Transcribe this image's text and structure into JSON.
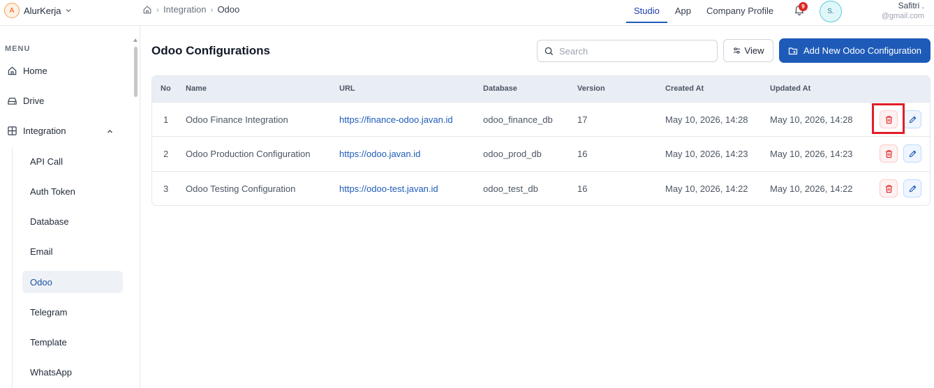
{
  "org": {
    "initial": "A",
    "name": "AlurKerja"
  },
  "breadcrumb": [
    "Integration",
    "Odoo"
  ],
  "topnav": [
    {
      "label": "Studio",
      "active": true
    },
    {
      "label": "App",
      "active": false
    },
    {
      "label": "Company Profile",
      "active": false
    }
  ],
  "notifications": {
    "count": "9"
  },
  "user": {
    "initials": "S.",
    "name": "Safitri .",
    "email": "@gmail.com"
  },
  "sidebar": {
    "menu_label": "MENU",
    "items": [
      {
        "label": "Home",
        "icon": "home-icon"
      },
      {
        "label": "Drive",
        "icon": "drive-icon"
      },
      {
        "label": "Integration",
        "icon": "grid-icon",
        "expanded": true
      }
    ],
    "sub_items": [
      {
        "label": "API Call",
        "active": false
      },
      {
        "label": "Auth Token",
        "active": false
      },
      {
        "label": "Database",
        "active": false
      },
      {
        "label": "Email",
        "active": false
      },
      {
        "label": "Odoo",
        "active": true
      },
      {
        "label": "Telegram",
        "active": false
      },
      {
        "label": "Template",
        "active": false
      },
      {
        "label": "WhatsApp",
        "active": false
      }
    ]
  },
  "main": {
    "title": "Odoo Configurations",
    "search": {
      "placeholder": "Search",
      "value": ""
    },
    "view_label": "View",
    "add_label": "Add New Odoo Configuration"
  },
  "table": {
    "columns": [
      "No",
      "Name",
      "URL",
      "Database",
      "Version",
      "Created At",
      "Updated At"
    ],
    "rows": [
      {
        "no": "1",
        "name": "Odoo Finance Integration",
        "url": "https://finance-odoo.javan.id",
        "database": "odoo_finance_db",
        "version": "17",
        "created": "May 10, 2026, 14:28",
        "updated": "May 10, 2026, 14:28"
      },
      {
        "no": "2",
        "name": "Odoo Production Configuration",
        "url": "https://odoo.javan.id",
        "database": "odoo_prod_db",
        "version": "16",
        "created": "May 10, 2026, 14:23",
        "updated": "May 10, 2026, 14:23"
      },
      {
        "no": "3",
        "name": "Odoo Testing Configuration",
        "url": "https://odoo-test.javan.id",
        "database": "odoo_test_db",
        "version": "16",
        "created": "May 10, 2026, 14:22",
        "updated": "May 10, 2026, 14:22"
      }
    ]
  },
  "colors": {
    "primary": "#1e5bb8",
    "danger": "#dc2626",
    "highlight": "#e11d2a"
  }
}
